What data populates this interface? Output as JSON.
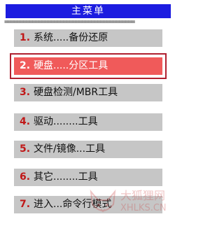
{
  "header": {
    "title": "主菜单",
    "separator": "=========================================="
  },
  "menu": {
    "selected_index": 1,
    "items": [
      {
        "number": "1.",
        "label": "系统.....备份还原"
      },
      {
        "number": "2.",
        "label": "硬盘.....分区工具"
      },
      {
        "number": "3.",
        "label": "硬盘检测/MBR工具"
      },
      {
        "number": "4.",
        "label": "驱动........工具"
      },
      {
        "number": "5.",
        "label": "文件/镜像...工具"
      },
      {
        "number": "6.",
        "label": "其它........工具"
      },
      {
        "number": "7.",
        "label": "进入...命令行模式"
      }
    ]
  },
  "watermark": {
    "site_name": "大狐狸网",
    "url": "XHLKS.CN"
  },
  "colors": {
    "title_bar": "#1c1ce0",
    "item_background": "#c6c6c6",
    "selected_background": "#f05a5a",
    "selection_frame": "#b02030",
    "number_color": "#c01818"
  }
}
